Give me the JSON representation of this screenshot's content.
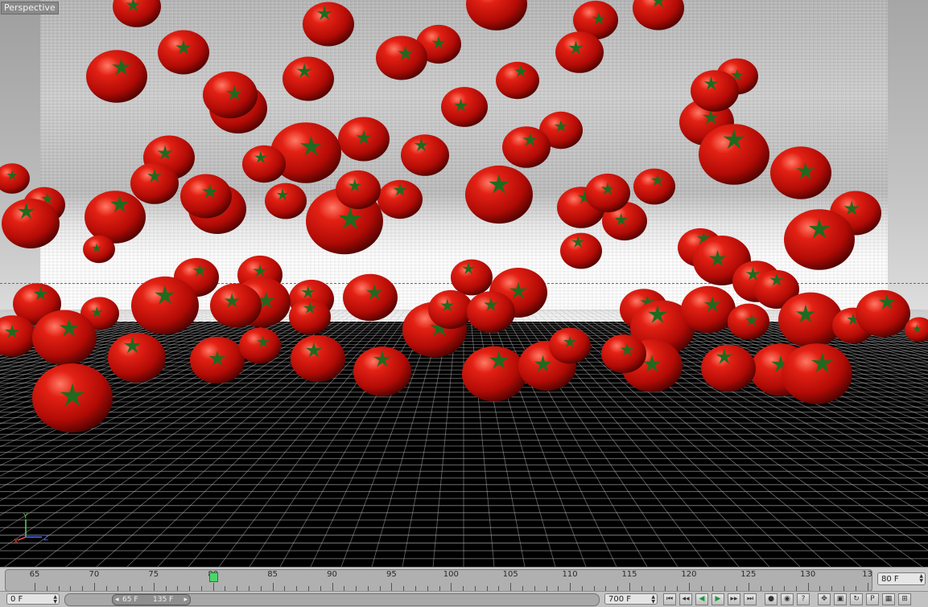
{
  "viewport": {
    "label": "Perspective",
    "axes": {
      "y": "Y",
      "x": "X",
      "z": "Z"
    }
  },
  "timeline": {
    "ticks": [
      "65",
      "70",
      "75",
      "80",
      "85",
      "90",
      "95",
      "100",
      "105",
      "110",
      "115",
      "120",
      "125",
      "130",
      "13"
    ],
    "current_frame": "80 F",
    "playhead_frame": 80
  },
  "transport": {
    "start_field": "0 F",
    "range_start": "65 F",
    "range_end": "135 F",
    "end_field": "700 F",
    "buttons": [
      {
        "name": "go-to-start-button",
        "icon": "go-to-start-icon",
        "glyph": "⏮"
      },
      {
        "name": "prev-key-button",
        "icon": "prev-key-icon",
        "glyph": "◂◂"
      },
      {
        "name": "play-backward-button",
        "icon": "play-backward-icon",
        "glyph": "◀"
      },
      {
        "name": "play-forward-button",
        "icon": "play-forward-icon",
        "glyph": "▶"
      },
      {
        "name": "next-key-button",
        "icon": "next-key-icon",
        "glyph": "▸▸"
      },
      {
        "name": "go-to-end-button",
        "icon": "go-to-end-icon",
        "glyph": "⏭"
      },
      {
        "name": "record-active-button",
        "icon": "record-icon",
        "glyph": "●"
      },
      {
        "name": "autokey-button",
        "icon": "autokey-icon",
        "glyph": "◉"
      },
      {
        "name": "keyframe-help-button",
        "icon": "help-icon",
        "glyph": "?"
      },
      {
        "name": "key-position-button",
        "icon": "move-icon",
        "glyph": "✥"
      },
      {
        "name": "key-scale-button",
        "icon": "scale-icon",
        "glyph": "▣"
      },
      {
        "name": "key-rotation-button",
        "icon": "rotate-icon",
        "glyph": "↻"
      },
      {
        "name": "key-parameter-button",
        "icon": "parameter-icon",
        "glyph": "P"
      },
      {
        "name": "key-pla-button",
        "icon": "grid-icon",
        "glyph": "▦"
      },
      {
        "name": "scheme-button",
        "icon": "scheme-icon",
        "glyph": "⊞"
      }
    ]
  },
  "colors": {
    "tomato": "#c8100c",
    "tomato_highlight": "#ff6a5a",
    "tomato_shadow": "#5a0402",
    "stem": "#1f6a1f",
    "playhead": "#4ad66a"
  }
}
